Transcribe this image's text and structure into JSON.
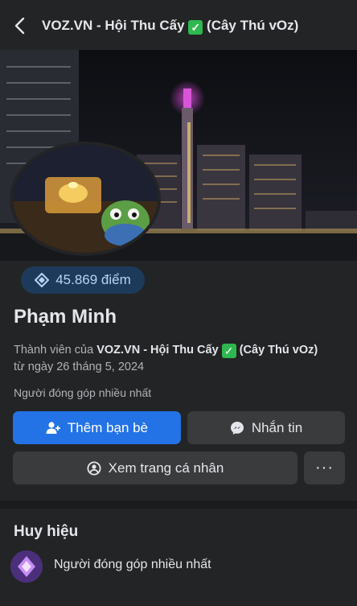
{
  "header": {
    "title": "VOZ.VN - Hội Thu Cấy",
    "title_suffix": "(Cây Thú vOz)",
    "check": "✓"
  },
  "profile": {
    "points": "45.869 điểm",
    "name": "Phạm Minh",
    "member_prefix": "Thành viên của",
    "group_name": "VOZ.VN - Hội Thu Cấy",
    "group_suffix": "(Cây Thú vOz)",
    "since": "từ ngày 26 tháng 5, 2024",
    "contributor": "Người đóng góp nhiều nhất"
  },
  "actions": {
    "add_friend": "Thêm bạn bè",
    "message": "Nhắn tin",
    "view_profile": "Xem trang cá nhân",
    "more": "···"
  },
  "badges": {
    "title": "Huy hiệu",
    "items": [
      {
        "label": "Người đóng góp nhiều nhất",
        "icon": "top-contributor-icon"
      }
    ]
  },
  "colors": {
    "background": "#232425",
    "primary_button": "#2473e6",
    "secondary_button": "#3a3b3c",
    "points_pill": "#1d3a5a",
    "checkmark": "#2eb84f"
  }
}
